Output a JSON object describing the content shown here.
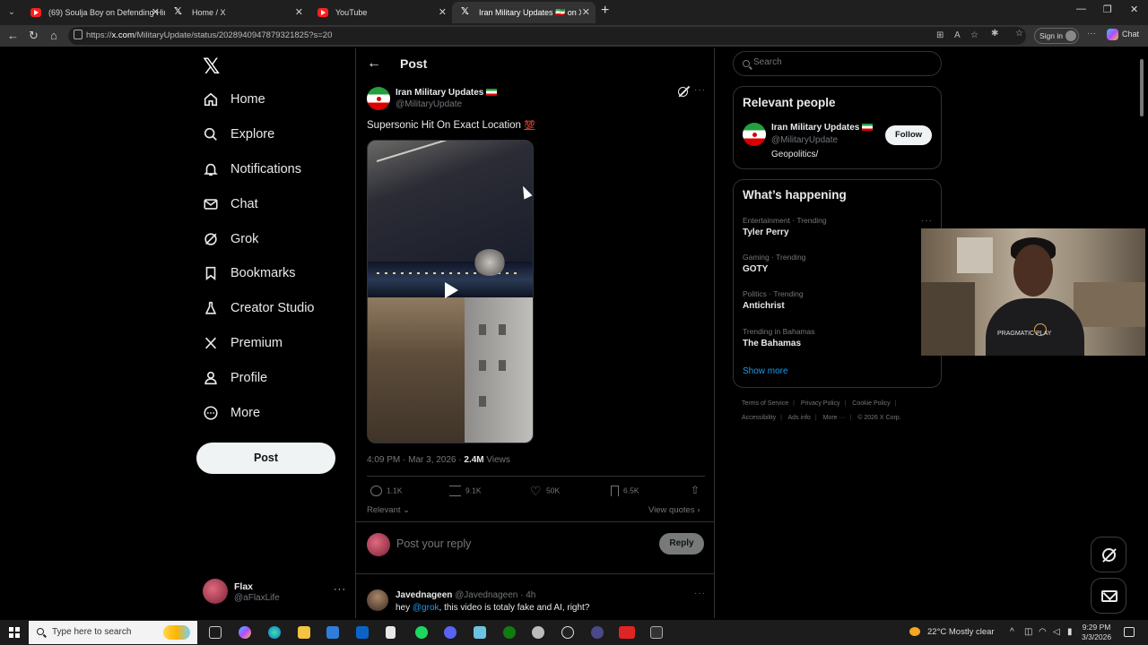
{
  "browser": {
    "tabs": [
      {
        "title": "(69) Soulja Boy on Defending Him",
        "favicon": "youtube-icon",
        "active": false
      },
      {
        "title": "Home / X",
        "favicon": "x-icon",
        "active": false
      },
      {
        "title": "YouTube",
        "favicon": "youtube-icon",
        "active": false
      },
      {
        "title": "Iran Military Updates 🇮🇷 on X: \"Sup",
        "favicon": "x-icon",
        "active": true
      }
    ],
    "url_prefix": "https://",
    "url_host": "x.com",
    "url_path": "/MilitaryUpdate/status/2028940947879321825?s=20",
    "signin_label": "Sign in",
    "chat_label": "Chat"
  },
  "nav": {
    "items": [
      {
        "label": "Home",
        "icon": "home-icon"
      },
      {
        "label": "Explore",
        "icon": "search-icon"
      },
      {
        "label": "Notifications",
        "icon": "bell-icon"
      },
      {
        "label": "Chat",
        "icon": "mail-icon"
      },
      {
        "label": "Grok",
        "icon": "grok-icon"
      },
      {
        "label": "Bookmarks",
        "icon": "bookmark-icon"
      },
      {
        "label": "Creator Studio",
        "icon": "flask-icon"
      },
      {
        "label": "Premium",
        "icon": "x-icon"
      },
      {
        "label": "Profile",
        "icon": "person-icon"
      },
      {
        "label": "More",
        "icon": "more-circle-icon"
      }
    ],
    "post_label": "Post",
    "account": {
      "name": "Flax",
      "handle": "@aFlaxLife"
    }
  },
  "header": {
    "title": "Post"
  },
  "post": {
    "author_name": "Iran Military Updates",
    "author_handle": "@MilitaryUpdate",
    "text": "Supersonic Hit On Exact Location",
    "emoji": "💯",
    "time": "4:09 PM · Mar 3, 2026 · ",
    "views_count": "2.4M",
    "views_label": " Views",
    "stats": {
      "replies": "1.1K",
      "reposts": "9.1K",
      "likes": "50K",
      "bookmarks": "6.5K"
    },
    "sort_label": "Relevant ⌄",
    "view_quotes_label": "View quotes ›"
  },
  "reply_box": {
    "placeholder": "Post your reply",
    "button": "Reply"
  },
  "comment": {
    "name": "Javednageen",
    "handle_time": " @Javednageen · 4h",
    "text_before": "hey ",
    "mention": "@grok",
    "text_after": ", this video is totaly fake and AI, right?"
  },
  "sidebar": {
    "search_placeholder": "Search",
    "relevant": {
      "title": "Relevant people",
      "name": "Iran Military Updates",
      "handle": "@MilitaryUpdate",
      "bio": "Geopolitics/",
      "follow_label": "Follow"
    },
    "happening": {
      "title": "What’s happening",
      "trends": [
        {
          "category": "Entertainment · Trending",
          "name": "Tyler Perry"
        },
        {
          "category": "Gaming · Trending",
          "name": "GOTY"
        },
        {
          "category": "Politics · Trending",
          "name": "Antichrist"
        },
        {
          "category": "Trending in Bahamas",
          "name": "The Bahamas"
        }
      ],
      "show_more": "Show more"
    },
    "footer_row1": [
      "Terms of Service",
      "Privacy Policy",
      "Cookie Policy"
    ],
    "footer_row2": [
      "Accessibility",
      "Ads info",
      "More ···",
      "© 2026 X Corp."
    ]
  },
  "webcam": {
    "brand_text": "PRAGMATIC PLAY"
  },
  "taskbar": {
    "search_placeholder": "Type here to search",
    "weather": "22°C  Mostly clear",
    "time": "9:29 PM",
    "date": "3/3/2026"
  },
  "colors": {
    "accent": "#1d9bf0",
    "background": "#000000",
    "text": "#e7e9ea",
    "muted": "#71767b",
    "border": "#2f3336"
  }
}
